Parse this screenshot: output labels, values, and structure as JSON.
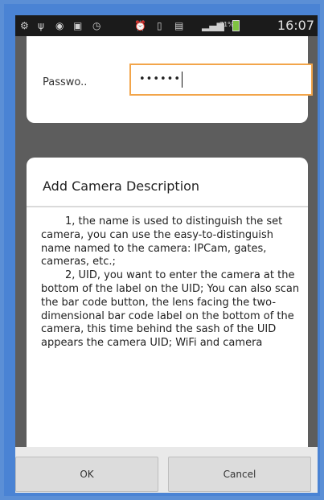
{
  "status_bar": {
    "time": "16:07",
    "battery_percent": "71%",
    "icons": [
      "settings-icon",
      "usb-icon",
      "app-icon",
      "image-icon",
      "clock-icon",
      "alarm-icon",
      "vibrate-icon",
      "sim-icon",
      "signal-icon",
      "battery-icon"
    ]
  },
  "form": {
    "password_label": "Passwo..",
    "password_value": "••••••"
  },
  "dialog": {
    "title": "Add Camera Description",
    "paragraphs": [
      "1, the name is used to distinguish the set camera, you can use the easy-to-distinguish name named to the camera: IPCam, gates, cameras, etc.;",
      "2, UID, you want to enter the camera at the bottom of the label on the UID; You can also scan the bar code button, the lens facing the two-dimensional bar code label on the bottom of the camera, this time behind the sash of the UID appears the camera UID; WiFi and camera"
    ]
  },
  "buttons": {
    "ok_label": "OK",
    "cancel_label": "Cancel"
  },
  "colors": {
    "frame": "#4a83d4",
    "input_focus_border": "#f2a54a",
    "battery": "#7fc241"
  }
}
